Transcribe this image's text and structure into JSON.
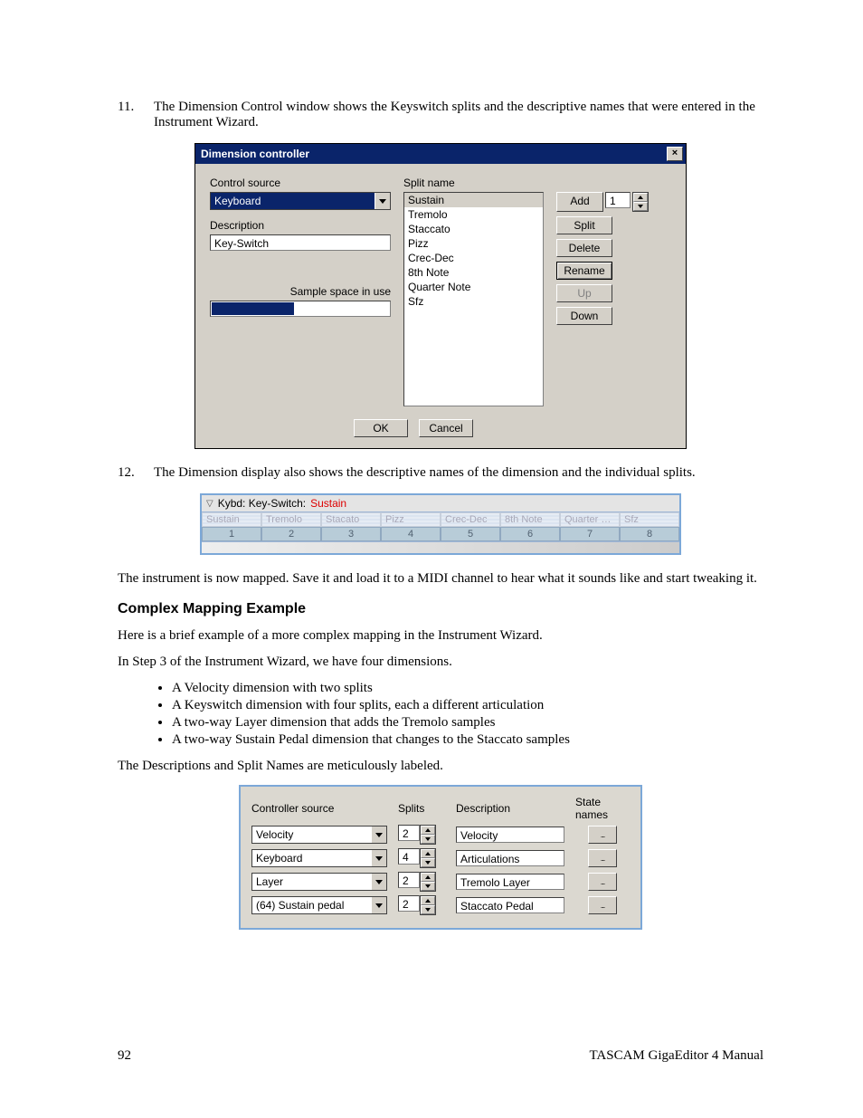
{
  "step11": {
    "num": "11.",
    "text": "The Dimension Control window shows the Keyswitch splits and the descriptive names that were entered in the Instrument Wizard."
  },
  "dc": {
    "title": "Dimension controller",
    "close_glyph": "×",
    "control_source_label": "Control source",
    "control_source_value": "Keyboard",
    "description_label": "Description",
    "description_value": "Key-Switch",
    "sample_space_label": "Sample space in use",
    "progress_pct": 46,
    "split_name_label": "Split name",
    "split_items": [
      "Sustain",
      "Tremolo",
      "Staccato",
      "Pizz",
      "Crec-Dec",
      "8th Note",
      "Quarter Note",
      "Sfz"
    ],
    "add_value": "1",
    "btn_add": "Add",
    "btn_split": "Split",
    "btn_delete": "Delete",
    "btn_rename": "Rename",
    "btn_up": "Up",
    "btn_down": "Down",
    "btn_ok": "OK",
    "btn_cancel": "Cancel"
  },
  "step12": {
    "num": "12.",
    "text": "The Dimension display also shows the descriptive names of the dimension and the individual splits."
  },
  "strip": {
    "title_prefix": "Kybd: Key-Switch:",
    "title_highlight": "Sustain",
    "labels": [
      "Sustain",
      "Tremolo",
      "Stacato",
      "Pizz",
      "Crec-Dec",
      "8th Note",
      "Quarter N...",
      "Sfz"
    ],
    "nums": [
      "1",
      "2",
      "3",
      "4",
      "5",
      "6",
      "7",
      "8"
    ]
  },
  "para_mapped": "The instrument is now mapped.  Save it and load it to a MIDI channel to hear what it sounds like and start tweaking it.",
  "heading_complex": "Complex Mapping Example",
  "para_complex_intro": "Here is a brief example of a more complex mapping in the Instrument Wizard.",
  "para_step3": "In Step 3 of the Instrument Wizard, we have four dimensions.",
  "bullets": [
    "A Velocity dimension with two splits",
    "A Keyswitch dimension with four splits, each a different articulation",
    "A two-way Layer dimension that adds the Tremolo samples",
    "A two-way Sustain Pedal dimension that changes to the Staccato samples"
  ],
  "para_labeled": "The Descriptions and Split Names are meticulously labeled.",
  "wiz": {
    "hdr_ctrl": "Controller source",
    "hdr_splits": "Splits",
    "hdr_desc": "Description",
    "hdr_state": "State names",
    "rows": [
      {
        "ctrl": "Velocity",
        "splits": "2",
        "desc": "Velocity"
      },
      {
        "ctrl": "Keyboard",
        "splits": "4",
        "desc": "Articulations"
      },
      {
        "ctrl": "Layer",
        "splits": "2",
        "desc": "Tremolo Layer"
      },
      {
        "ctrl": "(64) Sustain pedal",
        "splits": "2",
        "desc": "Staccato Pedal"
      }
    ],
    "state_btn": "..."
  },
  "footer": {
    "page": "92",
    "doc": "TASCAM GigaEditor 4 Manual"
  }
}
